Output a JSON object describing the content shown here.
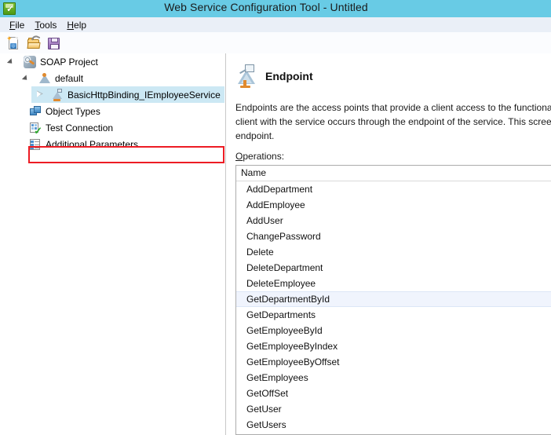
{
  "window": {
    "title": "Web Service Configuration Tool - Untitled",
    "icon": "app-checkmark-icon",
    "titlebar_color": "#68CBE5"
  },
  "menubar": {
    "items": [
      {
        "label": "File",
        "accel": "F",
        "rest": "ile"
      },
      {
        "label": "Tools",
        "accel": "T",
        "rest": "ools"
      },
      {
        "label": "Help",
        "accel": "H",
        "rest": "elp"
      }
    ]
  },
  "toolbar": {
    "buttons": [
      {
        "name": "new-project-button",
        "icon": "new-document-icon",
        "tooltip": "New"
      },
      {
        "name": "open-project-button",
        "icon": "open-folder-icon",
        "tooltip": "Open"
      },
      {
        "name": "save-project-button",
        "icon": "save-floppy-icon",
        "tooltip": "Save"
      }
    ]
  },
  "tree": {
    "nodes": [
      {
        "label": "SOAP Project",
        "icon": "soap-project-icon",
        "indent": 0,
        "twisty": "expanded",
        "selected": false
      },
      {
        "label": "default",
        "icon": "default-binding-icon",
        "indent": 1,
        "twisty": "expanded",
        "selected": false
      },
      {
        "label": "BasicHttpBinding_IEmployeeService",
        "icon": "endpoint-binding-icon",
        "indent": 2,
        "twisty": "collapsed",
        "selected": true
      },
      {
        "label": "Object Types",
        "icon": "object-types-icon",
        "indent": 1,
        "twisty": "none",
        "selected": false
      },
      {
        "label": "Test Connection",
        "icon": "test-connection-icon",
        "indent": 1,
        "twisty": "none",
        "selected": false
      },
      {
        "label": "Additional Parameters",
        "icon": "additional-parameters-icon",
        "indent": 1,
        "twisty": "none",
        "selected": false
      }
    ],
    "highlight_color": "#ED1C24"
  },
  "detail": {
    "icon": "endpoint-icon",
    "title": "Endpoint",
    "description": "Endpoints are the access points that provide a client access to the functiona\nclient with the service occurs through the endpoint of the service. This scree\nendpoint.",
    "operations_label": "Operations:",
    "operations_label_accel": "O",
    "operations_label_rest": "perations:"
  },
  "operations_list": {
    "column_header": "Name",
    "selected": "GetDepartmentById",
    "rows": [
      "AddDepartment",
      "AddEmployee",
      "AddUser",
      "ChangePassword",
      "Delete",
      "DeleteDepartment",
      "DeleteEmployee",
      "GetDepartmentById",
      "GetDepartments",
      "GetEmployeeById",
      "GetEmployeeByIndex",
      "GetEmployeeByOffset",
      "GetEmployees",
      "GetOffSet",
      "GetUser",
      "GetUsers"
    ]
  }
}
